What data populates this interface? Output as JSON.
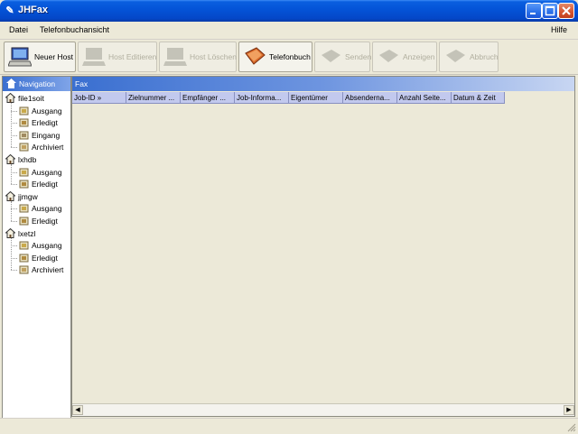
{
  "window": {
    "title": "JHFax"
  },
  "menu": {
    "datei": "Datei",
    "telefonbuchansicht": "Telefonbuchansicht",
    "hilfe": "Hilfe"
  },
  "toolbar": {
    "neuer_host": "Neuer Host",
    "host_editieren": "Host Editieren",
    "host_loeschen": "Host Löschen",
    "telefonbuch": "Telefonbuch",
    "senden": "Senden",
    "anzeigen": "Anzeigen",
    "abbruch": "Abbruch"
  },
  "navigation": {
    "header": "Navigation",
    "hosts": [
      {
        "name": "file1soit",
        "folders": [
          "Ausgang",
          "Erledigt",
          "Eingang",
          "Archiviert"
        ]
      },
      {
        "name": "lxhdb",
        "folders": [
          "Ausgang",
          "Erledigt"
        ]
      },
      {
        "name": "jjmgw",
        "folders": [
          "Ausgang",
          "Erledigt"
        ]
      },
      {
        "name": "lxetzl",
        "folders": [
          "Ausgang",
          "Erledigt",
          "Archiviert"
        ]
      }
    ]
  },
  "fax_panel": {
    "header": "Fax",
    "columns": [
      "Job-ID »",
      "Zielnummer ...",
      "Empfänger ...",
      "Job-Informa...",
      "Eigentümer",
      "Absenderna...",
      "Anzahl Seite...",
      "Datum & Zeit"
    ]
  },
  "icons": {
    "neuer_host": "computer-icon",
    "telefonbuch": "phonebook-icon",
    "disabled": "disabled-tool-icon"
  },
  "colors": {
    "titlebar": "#0454d8",
    "panel_header": "#3a6fd0",
    "column_header": "#c2c9ee"
  }
}
